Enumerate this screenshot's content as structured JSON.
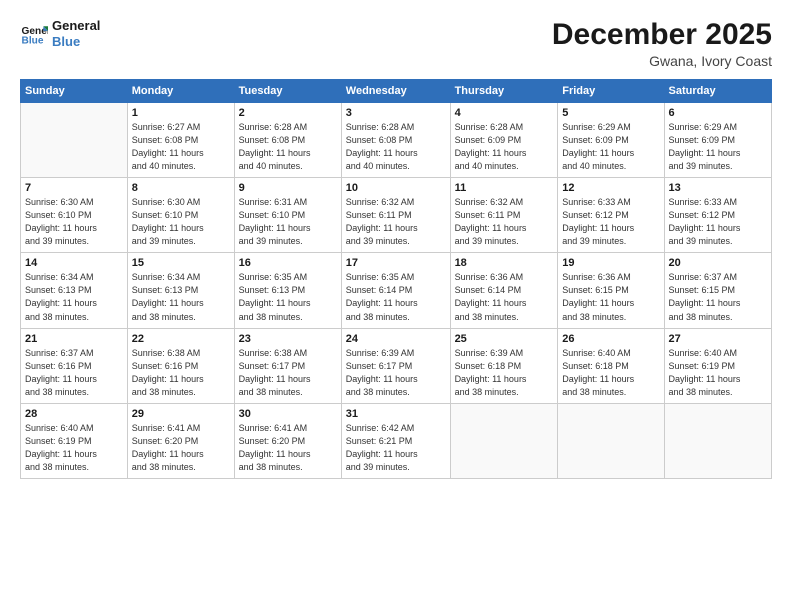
{
  "logo": {
    "line1": "General",
    "line2": "Blue"
  },
  "title": "December 2025",
  "subtitle": "Gwana, Ivory Coast",
  "days_header": [
    "Sunday",
    "Monday",
    "Tuesday",
    "Wednesday",
    "Thursday",
    "Friday",
    "Saturday"
  ],
  "weeks": [
    [
      {
        "day": "",
        "info": ""
      },
      {
        "day": "1",
        "info": "Sunrise: 6:27 AM\nSunset: 6:08 PM\nDaylight: 11 hours\nand 40 minutes."
      },
      {
        "day": "2",
        "info": "Sunrise: 6:28 AM\nSunset: 6:08 PM\nDaylight: 11 hours\nand 40 minutes."
      },
      {
        "day": "3",
        "info": "Sunrise: 6:28 AM\nSunset: 6:08 PM\nDaylight: 11 hours\nand 40 minutes."
      },
      {
        "day": "4",
        "info": "Sunrise: 6:28 AM\nSunset: 6:09 PM\nDaylight: 11 hours\nand 40 minutes."
      },
      {
        "day": "5",
        "info": "Sunrise: 6:29 AM\nSunset: 6:09 PM\nDaylight: 11 hours\nand 40 minutes."
      },
      {
        "day": "6",
        "info": "Sunrise: 6:29 AM\nSunset: 6:09 PM\nDaylight: 11 hours\nand 39 minutes."
      }
    ],
    [
      {
        "day": "7",
        "info": "Sunrise: 6:30 AM\nSunset: 6:10 PM\nDaylight: 11 hours\nand 39 minutes."
      },
      {
        "day": "8",
        "info": "Sunrise: 6:30 AM\nSunset: 6:10 PM\nDaylight: 11 hours\nand 39 minutes."
      },
      {
        "day": "9",
        "info": "Sunrise: 6:31 AM\nSunset: 6:10 PM\nDaylight: 11 hours\nand 39 minutes."
      },
      {
        "day": "10",
        "info": "Sunrise: 6:32 AM\nSunset: 6:11 PM\nDaylight: 11 hours\nand 39 minutes."
      },
      {
        "day": "11",
        "info": "Sunrise: 6:32 AM\nSunset: 6:11 PM\nDaylight: 11 hours\nand 39 minutes."
      },
      {
        "day": "12",
        "info": "Sunrise: 6:33 AM\nSunset: 6:12 PM\nDaylight: 11 hours\nand 39 minutes."
      },
      {
        "day": "13",
        "info": "Sunrise: 6:33 AM\nSunset: 6:12 PM\nDaylight: 11 hours\nand 39 minutes."
      }
    ],
    [
      {
        "day": "14",
        "info": "Sunrise: 6:34 AM\nSunset: 6:13 PM\nDaylight: 11 hours\nand 38 minutes."
      },
      {
        "day": "15",
        "info": "Sunrise: 6:34 AM\nSunset: 6:13 PM\nDaylight: 11 hours\nand 38 minutes."
      },
      {
        "day": "16",
        "info": "Sunrise: 6:35 AM\nSunset: 6:13 PM\nDaylight: 11 hours\nand 38 minutes."
      },
      {
        "day": "17",
        "info": "Sunrise: 6:35 AM\nSunset: 6:14 PM\nDaylight: 11 hours\nand 38 minutes."
      },
      {
        "day": "18",
        "info": "Sunrise: 6:36 AM\nSunset: 6:14 PM\nDaylight: 11 hours\nand 38 minutes."
      },
      {
        "day": "19",
        "info": "Sunrise: 6:36 AM\nSunset: 6:15 PM\nDaylight: 11 hours\nand 38 minutes."
      },
      {
        "day": "20",
        "info": "Sunrise: 6:37 AM\nSunset: 6:15 PM\nDaylight: 11 hours\nand 38 minutes."
      }
    ],
    [
      {
        "day": "21",
        "info": "Sunrise: 6:37 AM\nSunset: 6:16 PM\nDaylight: 11 hours\nand 38 minutes."
      },
      {
        "day": "22",
        "info": "Sunrise: 6:38 AM\nSunset: 6:16 PM\nDaylight: 11 hours\nand 38 minutes."
      },
      {
        "day": "23",
        "info": "Sunrise: 6:38 AM\nSunset: 6:17 PM\nDaylight: 11 hours\nand 38 minutes."
      },
      {
        "day": "24",
        "info": "Sunrise: 6:39 AM\nSunset: 6:17 PM\nDaylight: 11 hours\nand 38 minutes."
      },
      {
        "day": "25",
        "info": "Sunrise: 6:39 AM\nSunset: 6:18 PM\nDaylight: 11 hours\nand 38 minutes."
      },
      {
        "day": "26",
        "info": "Sunrise: 6:40 AM\nSunset: 6:18 PM\nDaylight: 11 hours\nand 38 minutes."
      },
      {
        "day": "27",
        "info": "Sunrise: 6:40 AM\nSunset: 6:19 PM\nDaylight: 11 hours\nand 38 minutes."
      }
    ],
    [
      {
        "day": "28",
        "info": "Sunrise: 6:40 AM\nSunset: 6:19 PM\nDaylight: 11 hours\nand 38 minutes."
      },
      {
        "day": "29",
        "info": "Sunrise: 6:41 AM\nSunset: 6:20 PM\nDaylight: 11 hours\nand 38 minutes."
      },
      {
        "day": "30",
        "info": "Sunrise: 6:41 AM\nSunset: 6:20 PM\nDaylight: 11 hours\nand 38 minutes."
      },
      {
        "day": "31",
        "info": "Sunrise: 6:42 AM\nSunset: 6:21 PM\nDaylight: 11 hours\nand 39 minutes."
      },
      {
        "day": "",
        "info": ""
      },
      {
        "day": "",
        "info": ""
      },
      {
        "day": "",
        "info": ""
      }
    ]
  ]
}
